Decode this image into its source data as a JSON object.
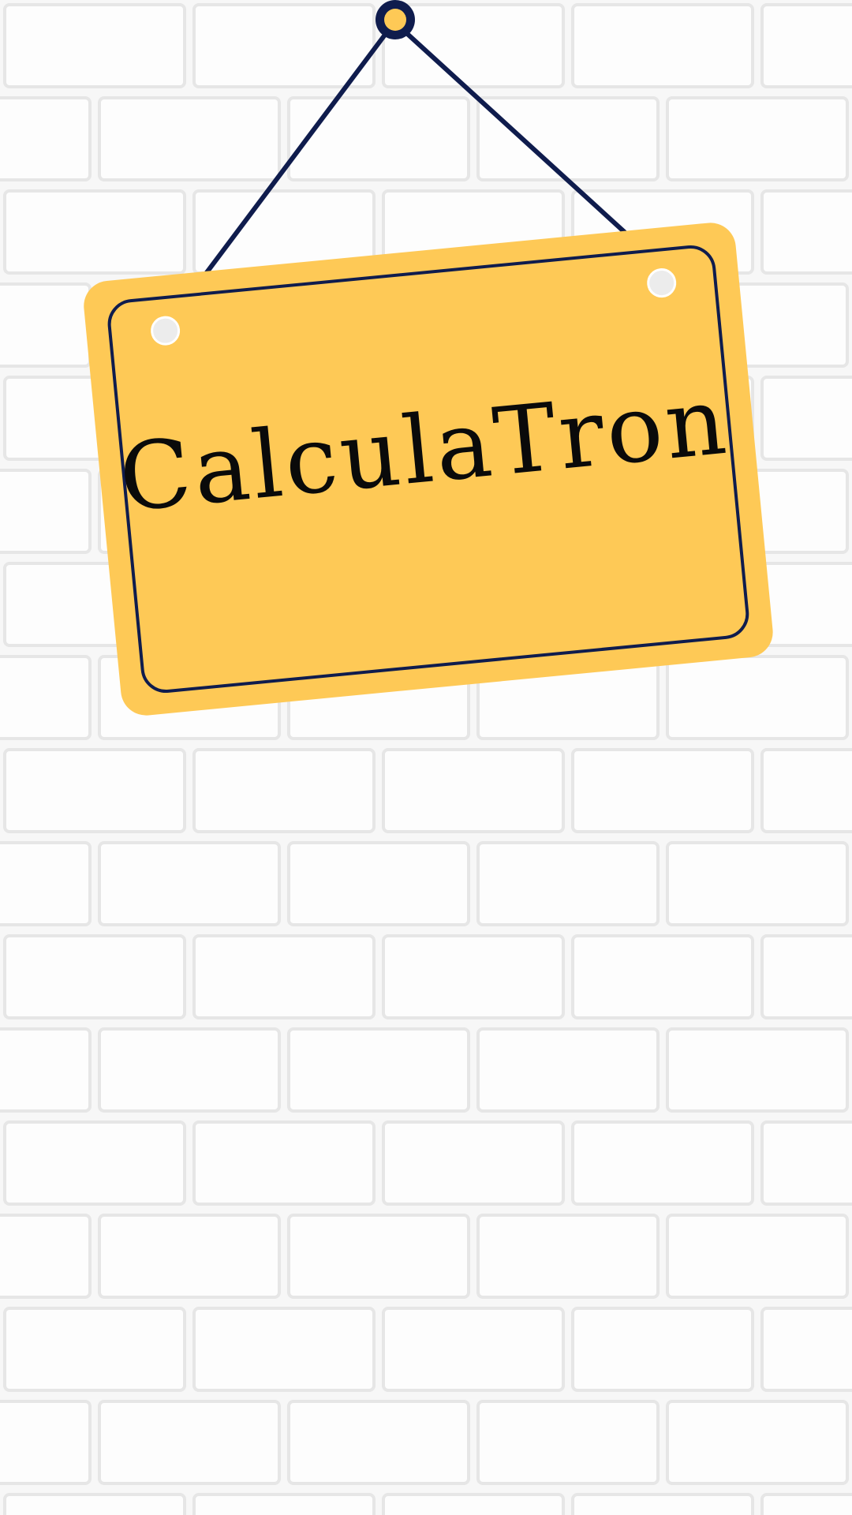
{
  "sign": {
    "title": "CalculaTron"
  },
  "colors": {
    "wall": "#f7f7f7",
    "mortar": "#e6e6e6",
    "sign_fill": "#fec956",
    "navy": "#0f1c4d",
    "hole": "#ececec"
  },
  "icons": {
    "nail": "nail-icon",
    "hole_left": "hole-icon",
    "hole_right": "hole-icon"
  }
}
